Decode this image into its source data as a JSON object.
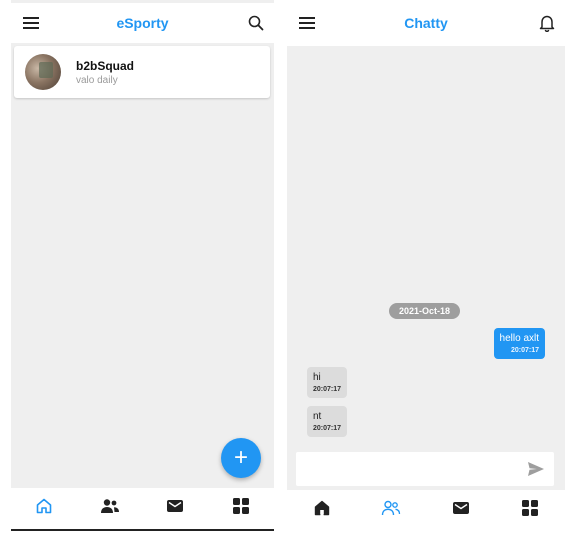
{
  "left_app": {
    "title": "eSporty",
    "menu_icon": "hamburger-menu-icon",
    "search_icon": "search-icon",
    "group": {
      "name": "b2bSquad",
      "subtitle": "valo daily"
    },
    "fab_label": "+",
    "bottom_nav": [
      {
        "icon": "home-icon",
        "active": true
      },
      {
        "icon": "people-icon",
        "active": false
      },
      {
        "icon": "mail-icon",
        "active": false
      },
      {
        "icon": "grid-icon",
        "active": false
      }
    ]
  },
  "right_app": {
    "title": "Chatty",
    "menu_icon": "hamburger-menu-icon",
    "bell_icon": "bell-icon",
    "date_chip": "2021-Oct-18",
    "messages": [
      {
        "direction": "outgoing",
        "text": "hello axlt",
        "time": "20:07:17"
      },
      {
        "direction": "incoming",
        "text": "hi",
        "time": "20:07:17"
      },
      {
        "direction": "incoming",
        "text": "nt",
        "time": "20:07:17"
      }
    ],
    "composer": {
      "value": "",
      "placeholder": ""
    },
    "bottom_nav": [
      {
        "icon": "home-icon",
        "active": false
      },
      {
        "icon": "people-icon",
        "active": true
      },
      {
        "icon": "mail-icon",
        "active": false
      },
      {
        "icon": "grid-icon",
        "active": false
      }
    ]
  },
  "colors": {
    "accent": "#2196f3",
    "background": "#efefef",
    "incoming_bubble": "#dcdcdc",
    "date_chip": "#9e9e9e",
    "nav_inactive": "#222222"
  }
}
